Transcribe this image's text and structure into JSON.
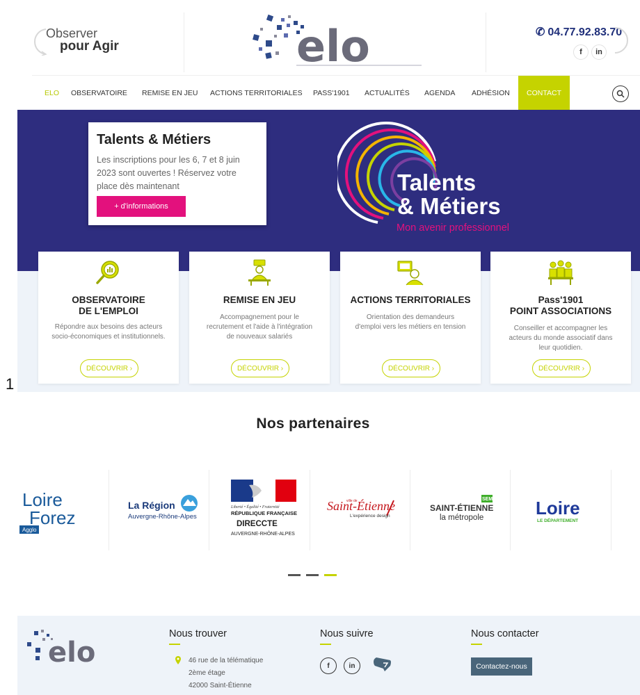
{
  "header": {
    "tagline_line1": "Observer",
    "tagline_line2": "pour Agir",
    "phone": "04.77.92.83.70",
    "social": [
      "f",
      "in"
    ],
    "logo_text": "elo"
  },
  "nav": {
    "items": [
      "ELO",
      "OBSERVATOIRE",
      "REMISE EN JEU",
      "ACTIONS TERRITORIALES",
      "PASS'1901",
      "ACTUALITÉS",
      "AGENDA",
      "ADHÉSION",
      "CONTACT"
    ],
    "active": "ELO"
  },
  "hero": {
    "card_title": "Talents & Métiers",
    "card_text": "Les inscriptions pour les 6, 7 et 8 juin 2023 sont ouvertes ! Réservez votre place dès maintenant",
    "card_button": "+ d'informations",
    "graphic_line1": "Talents",
    "graphic_line2": "& Métiers",
    "graphic_sub": "Mon avenir professionnel"
  },
  "cards": [
    {
      "title_line1": "OBSERVATOIRE",
      "title_line2": "DE L'EMPLOI",
      "text": [
        "Répondre aux besoins des acteurs",
        "socio-économiques et institutionnels."
      ],
      "button": "DÉCOUVRIR ›",
      "icon": "magnifier-chart-icon"
    },
    {
      "title_line1": "REMISE EN JEU",
      "title_line2": "",
      "text": [
        "Accompagnement pour le",
        "recrutement et l'aide à l'intégration",
        "de nouveaux salariés"
      ],
      "button": "DÉCOUVRIR ›",
      "icon": "desk-person-icon"
    },
    {
      "title_line1": "ACTIONS TERRITORIALES",
      "title_line2": "",
      "text": [
        "Orientation des demandeurs",
        "d'emploi vers les métiers en tension"
      ],
      "button": "DÉCOUVRIR ›",
      "icon": "person-screen-icon"
    },
    {
      "title_line1": "Pass'1901",
      "title_line2": "POINT ASSOCIATIONS",
      "text": [
        "Conseiller et accompagner les",
        "acteurs du monde associatif dans",
        "leur quotidien."
      ],
      "button": "DÉCOUVRIR ›",
      "icon": "group-people-icon"
    }
  ],
  "stray_char": "1",
  "partners": {
    "title": "Nos partenaires",
    "items": [
      {
        "name": "Loire Forez",
        "line1": "Loire",
        "line2": "Forez",
        "badge": "Agglo"
      },
      {
        "name": "La Région",
        "line1": "La Région",
        "line2": "Auvergne-Rhône-Alpes"
      },
      {
        "name": "DIRECCTE",
        "line1": "Liberté • Égalité • Fraternité",
        "line2": "RÉPUBLIQUE FRANÇAISE",
        "line3": "DIRECCTE",
        "line4": "AUVERGNE-RHÔNE-ALPES"
      },
      {
        "name": "Saint-Étienne",
        "line1": "Saint-Étienne",
        "line2": "L'expérience design",
        "prefix": "ville de"
      },
      {
        "name": "Saint-Étienne la métropole",
        "line1": "SAINT-ÉTIENNE",
        "line2": "la métropole",
        "badge": "SEM"
      },
      {
        "name": "Loire le département",
        "line1": "Loire",
        "line2": "LE DÉPARTEMENT"
      }
    ]
  },
  "footer": {
    "find_title": "Nous trouver",
    "address": [
      "46 rue de la télématique",
      "2ème étage",
      "42000 Saint-Étienne"
    ],
    "follow_title": "Nous suivre",
    "social": [
      "f",
      "in"
    ],
    "contact_title": "Nous contacter",
    "contact_button": "Contactez-nous"
  },
  "colors": {
    "accent_green": "#c5d300",
    "hero_blue": "#2e2d7f",
    "pink": "#e3117d",
    "footer_button": "#49657a"
  }
}
